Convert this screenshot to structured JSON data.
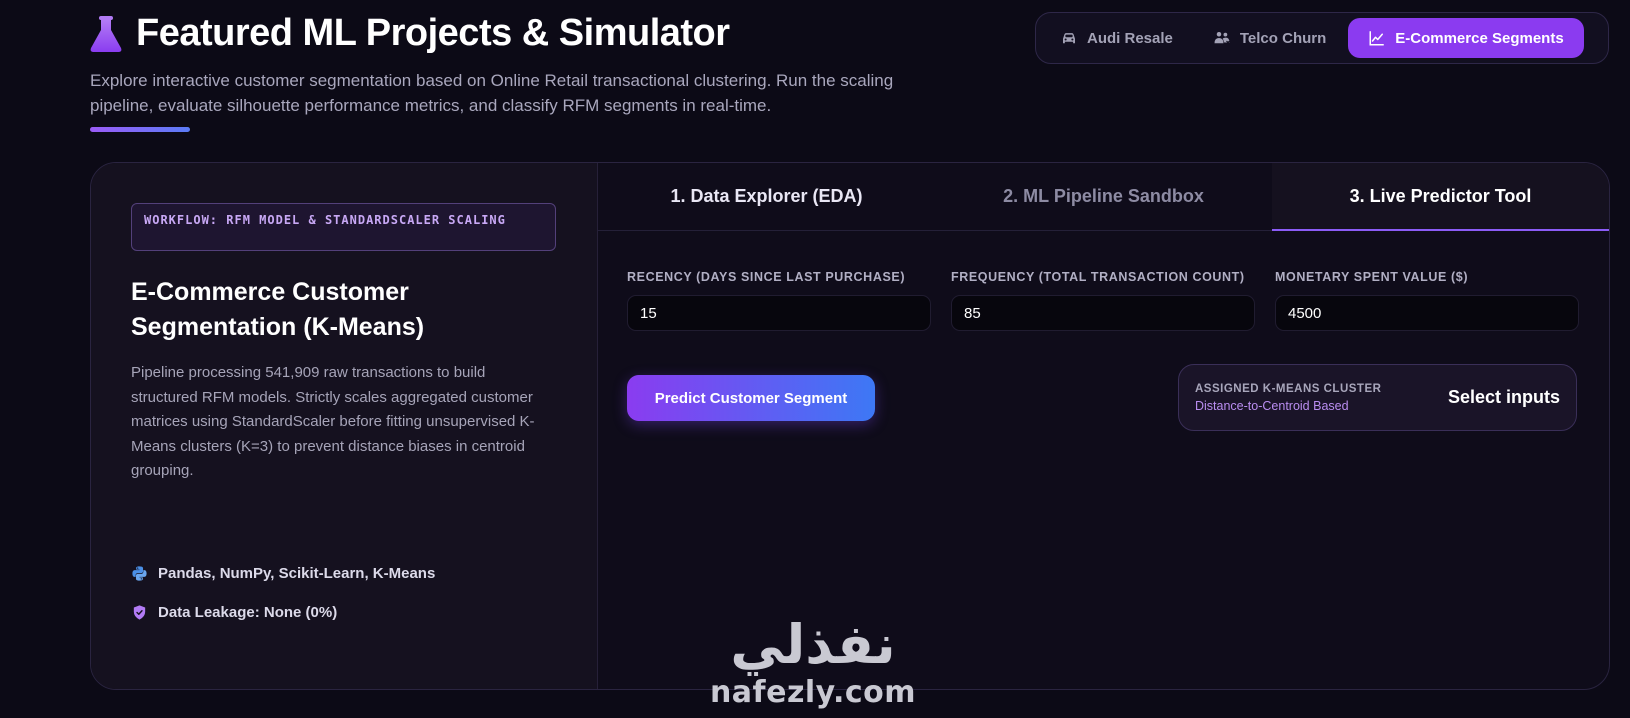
{
  "header": {
    "title": "Featured ML Projects & Simulator",
    "subtitle": "Explore interactive customer segmentation based on Online Retail transactional clustering. Run the scaling pipeline, evaluate silhouette performance metrics, and classify RFM segments in real-time.",
    "icon": "flask-icon"
  },
  "project_tabs": [
    {
      "label": "Audi Resale",
      "icon": "car-icon",
      "active": false
    },
    {
      "label": "Telco Churn",
      "icon": "users-icon",
      "active": false
    },
    {
      "label": "E-Commerce Segments",
      "icon": "line-chart-icon",
      "active": true
    }
  ],
  "left_panel": {
    "badge": "WORKFLOW: RFM MODEL & STANDARDSCALER SCALING",
    "title": "E-Commerce Customer Segmentation (K-Means)",
    "description": "Pipeline processing 541,909 raw transactions to build structured RFM models. Strictly scales aggregated customer matrices using StandardScaler before fitting unsupervised K-Means clusters (K=3) to prevent distance biases in centroid grouping.",
    "tech_stack": "Pandas, NumPy, Scikit-Learn, K-Means",
    "leakage": "Data Leakage: None (0%)"
  },
  "section_tabs": [
    {
      "label": "1. Data Explorer (EDA)",
      "active": false
    },
    {
      "label": "2. ML Pipeline Sandbox",
      "active": false
    },
    {
      "label": "3. Live Predictor Tool",
      "active": true
    }
  ],
  "fields": {
    "recency": {
      "label": "RECENCY (DAYS SINCE LAST PURCHASE)",
      "value": "15"
    },
    "frequency": {
      "label": "FREQUENCY (TOTAL TRANSACTION COUNT)",
      "value": "85"
    },
    "monetary": {
      "label": "MONETARY SPENT VALUE ($)",
      "value": "4500"
    }
  },
  "predict_button": "Predict Customer Segment",
  "result": {
    "label": "ASSIGNED K-MEANS CLUSTER",
    "sublabel": "Distance-to-Centroid Based",
    "value": "Select inputs"
  },
  "watermark": {
    "arabic": "نفذلي",
    "latin": "nafezly.com"
  },
  "colors": {
    "background": "#0c0a16",
    "accent_purple": "#8b3bf0",
    "accent_blue": "#3d78f5"
  }
}
